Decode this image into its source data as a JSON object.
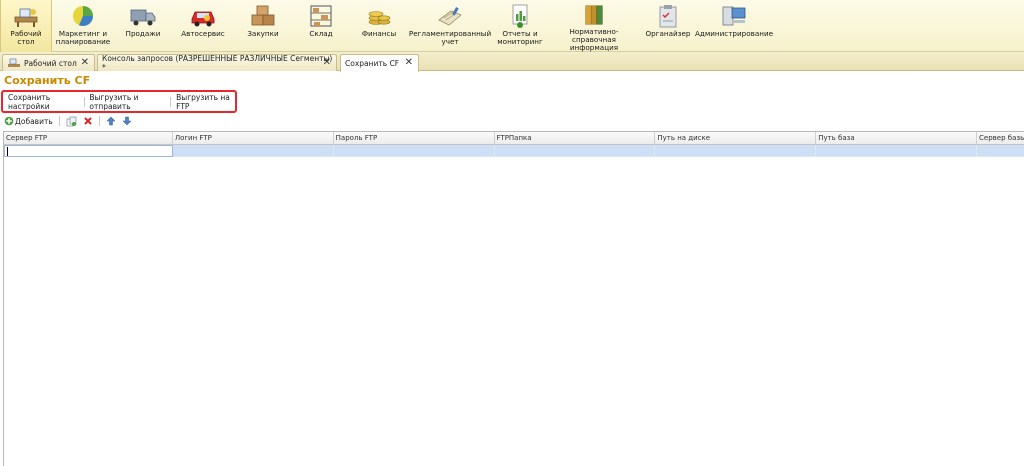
{
  "sections": [
    {
      "label": "Рабочий\nстол",
      "icon": "desk-icon",
      "active": true
    },
    {
      "label": "Маркетинг и\nпланирование",
      "icon": "pie-chart-icon"
    },
    {
      "label": "Продажи",
      "icon": "truck-icon"
    },
    {
      "label": "Автосервис",
      "icon": "car-icon"
    },
    {
      "label": "Закупки",
      "icon": "boxes-icon"
    },
    {
      "label": "Склад",
      "icon": "warehouse-shelf-icon"
    },
    {
      "label": "Финансы",
      "icon": "coins-icon"
    },
    {
      "label": "Регламентированный\nучет",
      "icon": "ledger-icon"
    },
    {
      "label": "Отчеты и\nмониторинг",
      "icon": "report-icon"
    },
    {
      "label": "Нормативно-справочная\nинформация",
      "icon": "binders-icon"
    },
    {
      "label": "Органайзер",
      "icon": "clipboard-icon"
    },
    {
      "label": "Администрирование",
      "icon": "computer-icon"
    }
  ],
  "tabs": [
    {
      "label": "Рабочий стол",
      "close": "✕"
    },
    {
      "label": "Консоль запросов (РАЗРЕШЕННЫЕ РАЗЛИЧНЫЕ  Сегменты) *",
      "close": "✕"
    },
    {
      "label": "Сохранить CF",
      "close": "✕",
      "active": true
    }
  ],
  "form": {
    "title": "Сохранить CF",
    "commands": [
      "Сохранить настройки",
      "Выгрузить и отправить",
      "Выгрузить на FTP"
    ],
    "add_label": "Добавить"
  },
  "table": {
    "columns": [
      "Сервер FTP",
      "Логин FTP",
      "Пароль FTP",
      "FTPПапка",
      "Путь на диске",
      "Путь база",
      "Сервер базы"
    ],
    "rows": [
      [
        "",
        "",
        "",
        "",
        "",
        "",
        ""
      ]
    ]
  },
  "colors": {
    "title": "#c98a00",
    "highlight_border": "#e8262b",
    "row_selected": "#cddff5"
  }
}
